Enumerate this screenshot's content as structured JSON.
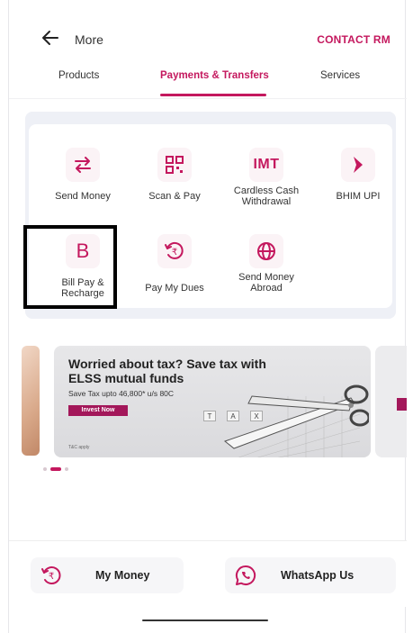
{
  "header": {
    "back_label": "More",
    "contact_label": "CONTACT RM"
  },
  "tabs": [
    {
      "label": "Products",
      "active": false
    },
    {
      "label": "Payments & Transfers",
      "active": true
    },
    {
      "label": "Services",
      "active": false
    }
  ],
  "services": [
    {
      "label": "Send Money",
      "icon": "transfer-arrows-icon"
    },
    {
      "label": "Scan & Pay",
      "icon": "qr-code-icon"
    },
    {
      "label": "Cardless Cash Withdrawal",
      "icon": "imt-icon",
      "icon_text": "IMT"
    },
    {
      "label": "BHIM UPI",
      "icon": "bhim-upi-icon"
    },
    {
      "label": "Bill Pay & Recharge",
      "icon": "bill-pay-icon",
      "icon_text": "B"
    },
    {
      "label": "Pay My Dues",
      "icon": "rupee-dues-icon"
    },
    {
      "label": "Send Money Abroad",
      "icon": "globe-icon"
    }
  ],
  "banner": {
    "title": "Worried about tax? Save tax with ELSS mutual funds",
    "subtitle": "Save Tax upto 46,800* u/s 80C",
    "cta": "Invest Now",
    "fineprint": "T&C apply",
    "keys": [
      "T",
      "A",
      "X"
    ]
  },
  "carousel": {
    "count": 4,
    "active_index": 1
  },
  "bottom": {
    "my_money": "My Money",
    "whatsapp": "WhatsApp Us"
  },
  "colors": {
    "accent": "#c4185e",
    "panel": "#eef0f6"
  }
}
